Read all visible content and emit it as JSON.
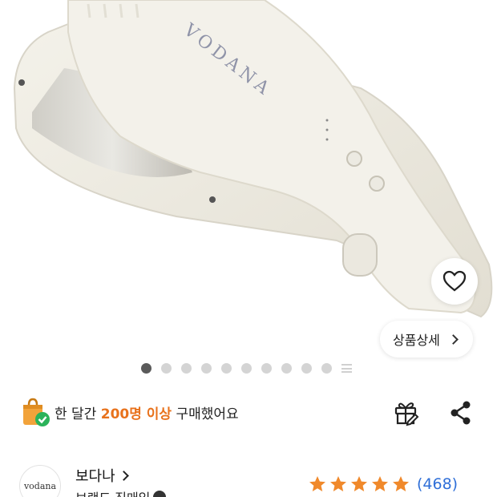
{
  "product": {
    "brand_mark": "VODANA",
    "detail_button_label": "상품상세"
  },
  "pager": {
    "total": 10,
    "active_index": 0
  },
  "social_proof": {
    "prefix": "한 달간 ",
    "highlight": "200명 이상",
    "suffix": " 구매했어요"
  },
  "brand": {
    "logo_text": "vodana",
    "name": "보다나",
    "sub": "브랜드 직매입"
  },
  "rating": {
    "stars": 5,
    "review_count": "(468)"
  },
  "colors": {
    "accent": "#e8721c",
    "star": "#f0892b",
    "link": "#2f6fd8"
  },
  "icons": [
    "heart-icon",
    "chevron-right-icon",
    "shopping-bag-icon",
    "check-icon",
    "gift-icon",
    "share-icon",
    "verified-icon",
    "star-icon"
  ]
}
